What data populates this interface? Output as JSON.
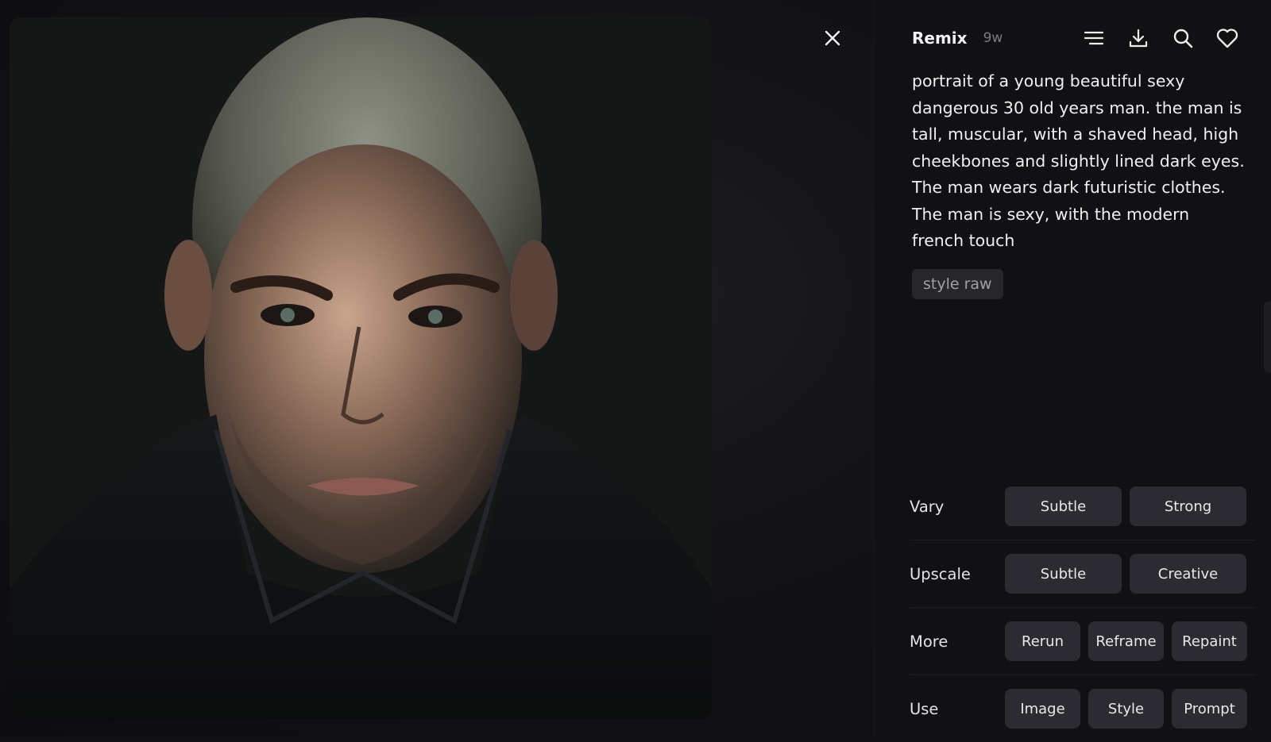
{
  "header": {
    "title": "Remix",
    "age": "9w"
  },
  "toolbar": {
    "icons": [
      "menu-icon",
      "download-icon",
      "search-icon",
      "heart-icon"
    ]
  },
  "prompt": {
    "text": "portrait of a young beautiful sexy dangerous 30 old years man. the man is tall, muscular, with a shaved head, high cheekbones and slightly lined dark eyes. The man wears dark futuristic clothes. The man is sexy, with the modern french touch"
  },
  "tags": [
    "style raw"
  ],
  "actions": [
    {
      "label": "Vary",
      "buttons": [
        "Subtle",
        "Strong"
      ]
    },
    {
      "label": "Upscale",
      "buttons": [
        "Subtle",
        "Creative"
      ]
    },
    {
      "label": "More",
      "buttons": [
        "Rerun",
        "Reframe",
        "Repaint"
      ]
    },
    {
      "label": "Use",
      "buttons": [
        "Image",
        "Style",
        "Prompt"
      ]
    }
  ],
  "colors": {
    "background": "#0f0f12",
    "button": "#2b2b31",
    "tag": "#26262b"
  }
}
